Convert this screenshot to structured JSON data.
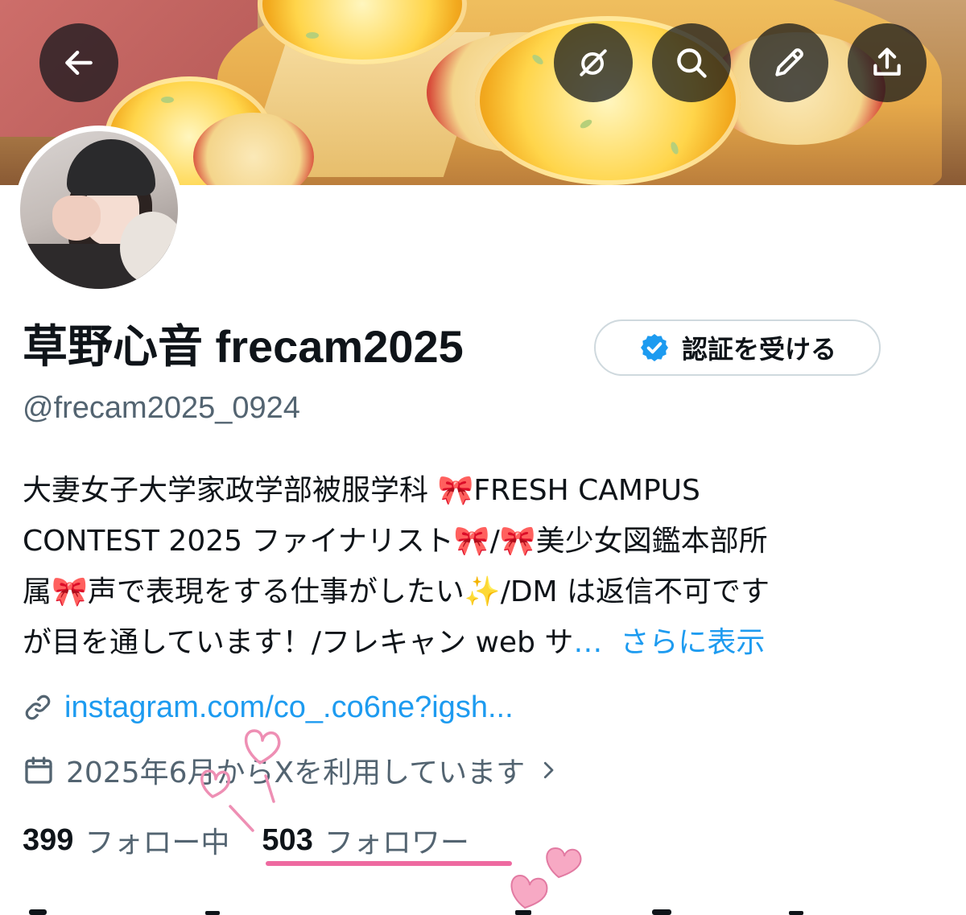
{
  "header": {
    "back_label": "back",
    "actions": [
      "grok",
      "search",
      "edit",
      "share"
    ]
  },
  "profile": {
    "display_name": "草野心音 frecam2025",
    "verify_button_label": "認証を受ける",
    "handle": "@frecam2025_0924",
    "bio": {
      "line1_text": "大妻女子大学家政学部被服学科 ",
      "line1_emoji": "🎀",
      "line1_tail": "FRESH CAMPUS",
      "line2_text": "CONTEST 2025 ファイナリスト",
      "line2_emoji1": "🎀",
      "line2_slash": "/",
      "line2_emoji2": "🎀",
      "line2_tail": "美少女図鑑本部所",
      "line3_head": "属",
      "line3_emoji": "🎀",
      "line3_text": "声で表現をする仕事がしたい",
      "line3_sparkle": "✨",
      "line3_tail": "/DM は返信不可です",
      "line4_text": "が目を通しています！/フレキャン web サ",
      "line4_ellipsis": "…",
      "show_more": "さらに表示"
    },
    "link": "instagram.com/co_.co6ne?igsh...",
    "joined": "2025年6月からXを利用しています",
    "following_count": "399",
    "following_label": "フォロー中",
    "followers_count": "503",
    "followers_label": "フォロワー"
  },
  "icons": {
    "back": "arrow-left-icon",
    "grok": "grok-icon",
    "search": "search-icon",
    "edit": "pencil-icon",
    "share": "share-icon",
    "verified": "verified-badge-icon",
    "link": "link-icon",
    "calendar": "calendar-icon",
    "chevron": "chevron-right-icon"
  },
  "colors": {
    "accent": "#1d9bf0",
    "text_primary": "#0f1419",
    "text_secondary": "#536471",
    "pink_deco": "#ee6aa0"
  }
}
